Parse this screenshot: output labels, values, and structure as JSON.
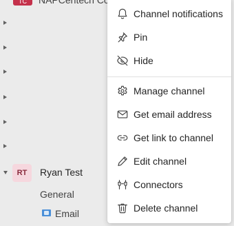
{
  "background": {
    "top_team": {
      "avatar_text": "TC",
      "name": "NAPCentech Co"
    },
    "team": {
      "avatar_text": "RT",
      "name": "Ryan Test"
    },
    "channels": [
      "General",
      "Email"
    ]
  },
  "menu": {
    "items": [
      {
        "label": "Channel notifications",
        "icon": "bell-icon"
      },
      {
        "label": "Pin",
        "icon": "pin-icon"
      },
      {
        "label": "Hide",
        "icon": "eye-off-icon"
      },
      {
        "label": "Manage channel",
        "icon": "gear-icon"
      },
      {
        "label": "Get email address",
        "icon": "mail-icon"
      },
      {
        "label": "Get link to channel",
        "icon": "link-icon"
      },
      {
        "label": "Edit channel",
        "icon": "pencil-icon"
      },
      {
        "label": "Connectors",
        "icon": "connector-icon"
      },
      {
        "label": "Delete channel",
        "icon": "trash-icon"
      }
    ]
  }
}
